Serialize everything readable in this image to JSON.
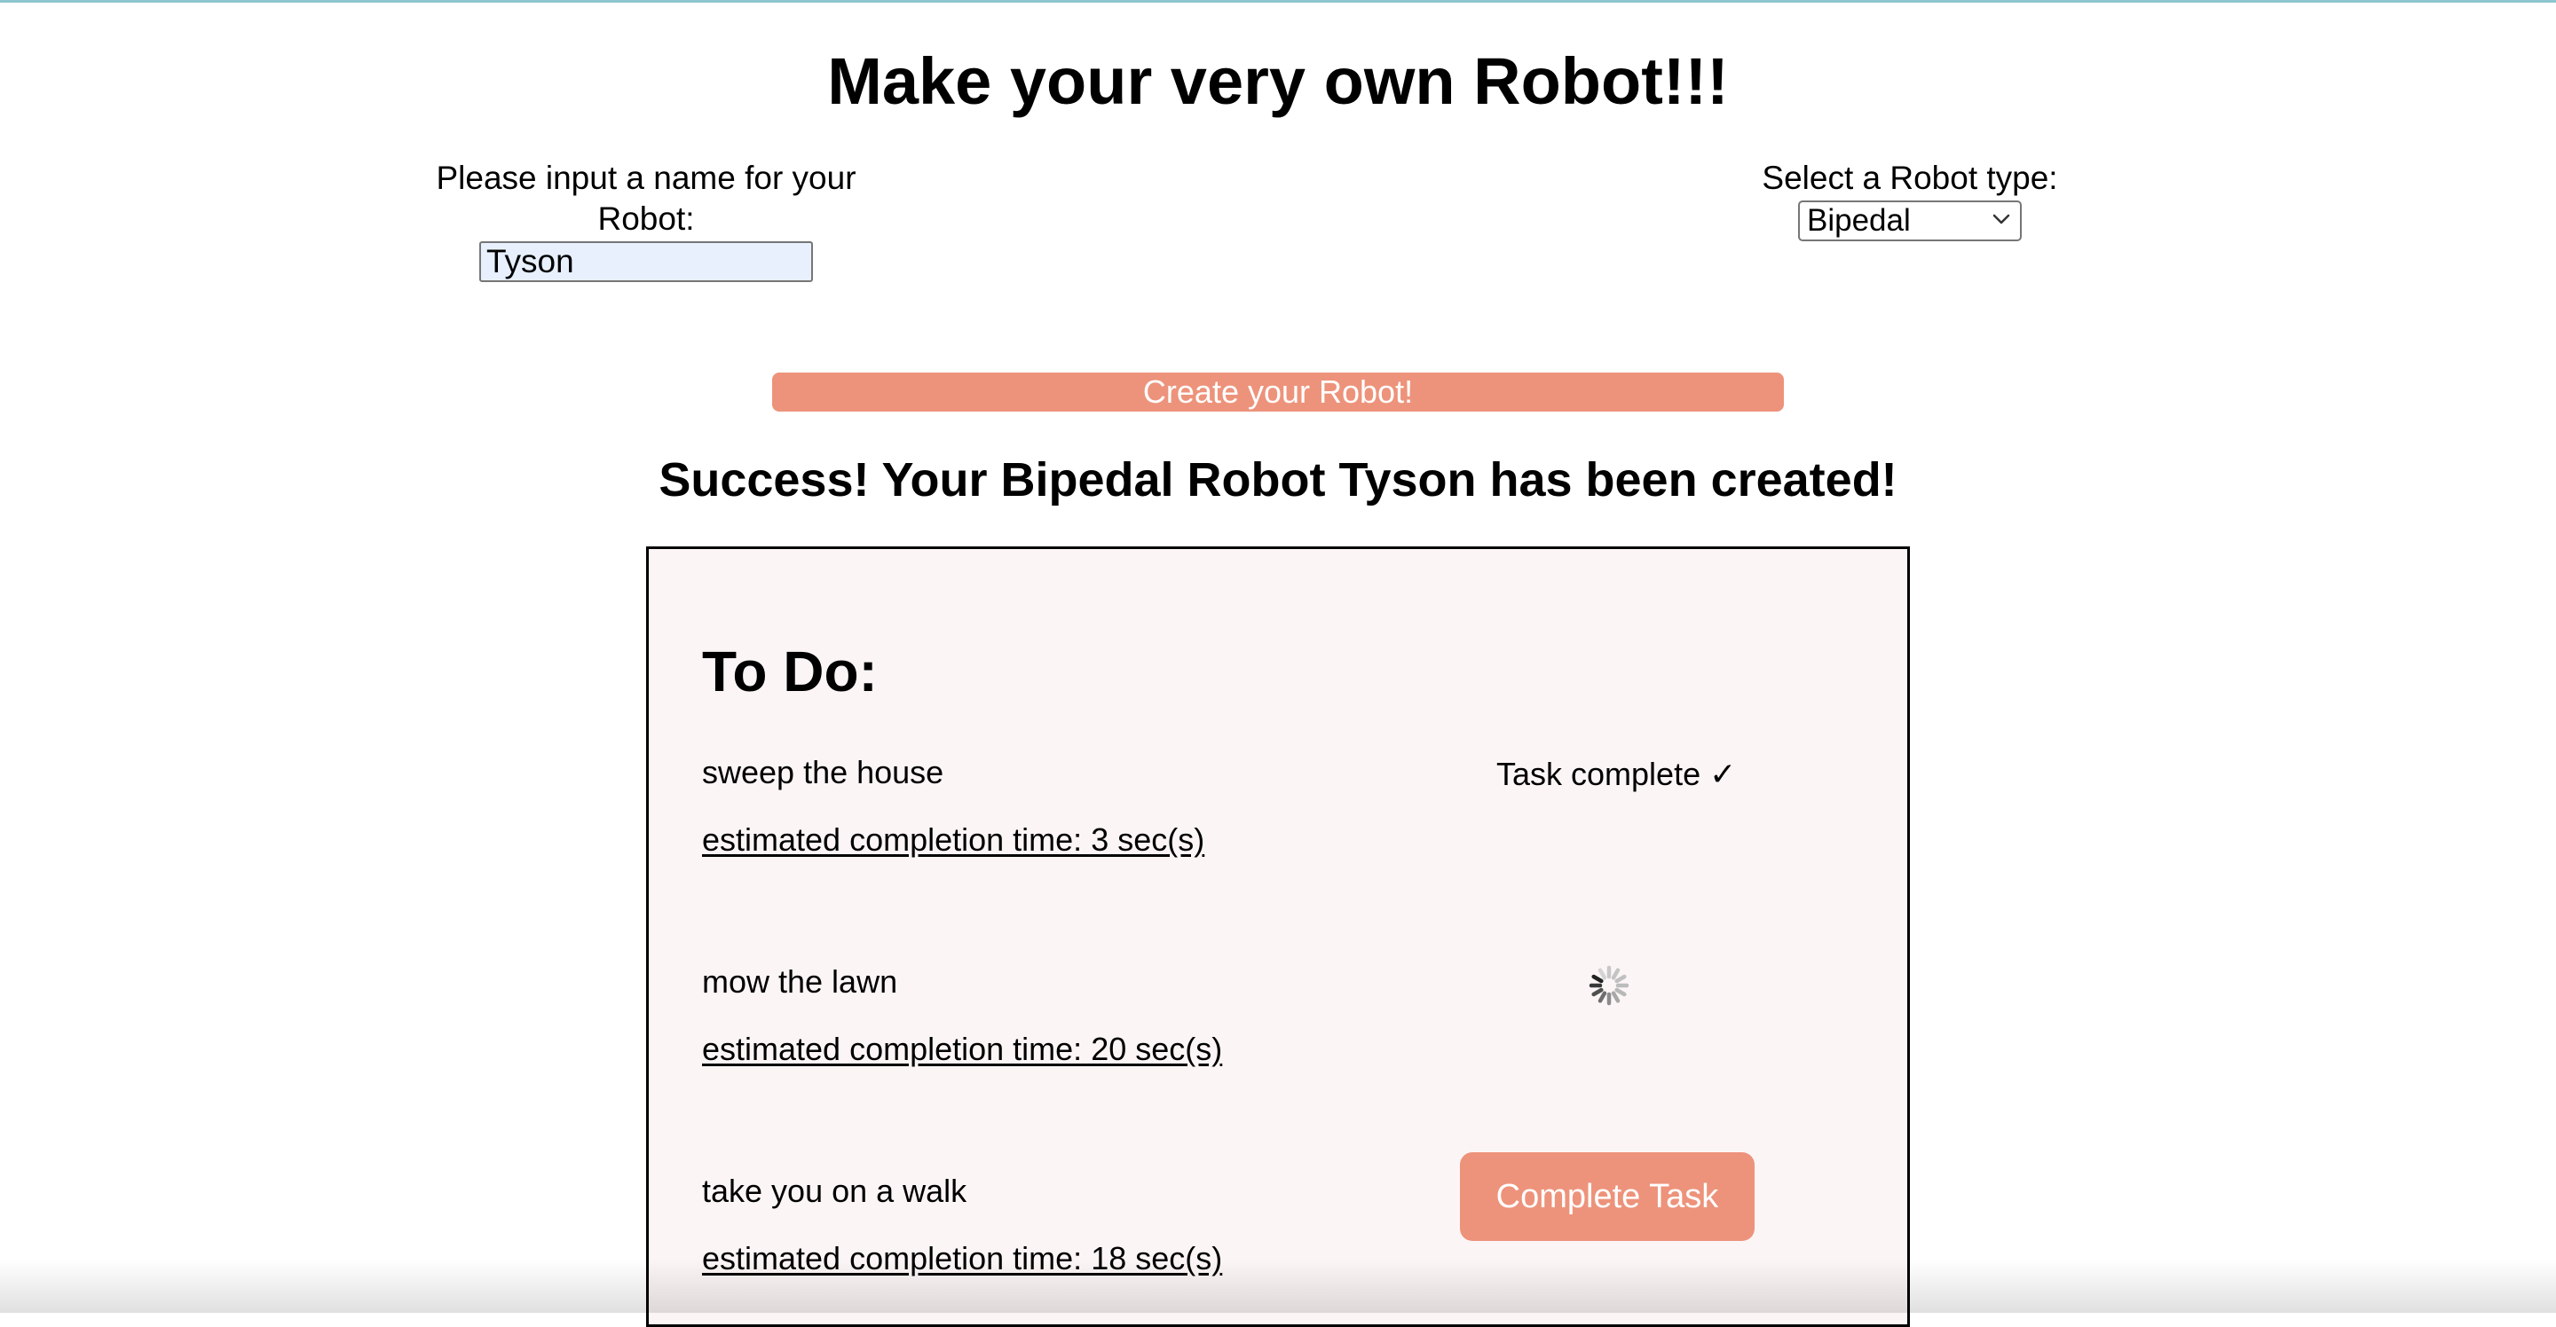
{
  "page": {
    "title": "Make your very own Robot!!!"
  },
  "form": {
    "name_label": "Please input a name for your Robot:",
    "name_value": "Tyson",
    "type_label": "Select a Robot type:",
    "type_value": "Bipedal",
    "create_button_label": "Create your Robot!"
  },
  "result": {
    "success_message": "Success! Your Bipedal Robot Tyson has been created!"
  },
  "todo": {
    "heading": "To Do:",
    "tasks": [
      {
        "name": "sweep the house",
        "estimate": "estimated completion time: 3 sec(s)",
        "state": "complete",
        "status_text": "Task complete ✓"
      },
      {
        "name": "mow the lawn",
        "estimate": "estimated completion time: 20 sec(s)",
        "state": "in-progress",
        "status_icon": "loading-spinner-icon"
      },
      {
        "name": "take you on a walk",
        "estimate": "estimated completion time: 18 sec(s)",
        "state": "pending",
        "action_label": "Complete Task"
      }
    ]
  },
  "colors": {
    "accent": "#ed937b",
    "panel_background": "#fcf5f5",
    "input_autofill": "#e8f0fe"
  }
}
